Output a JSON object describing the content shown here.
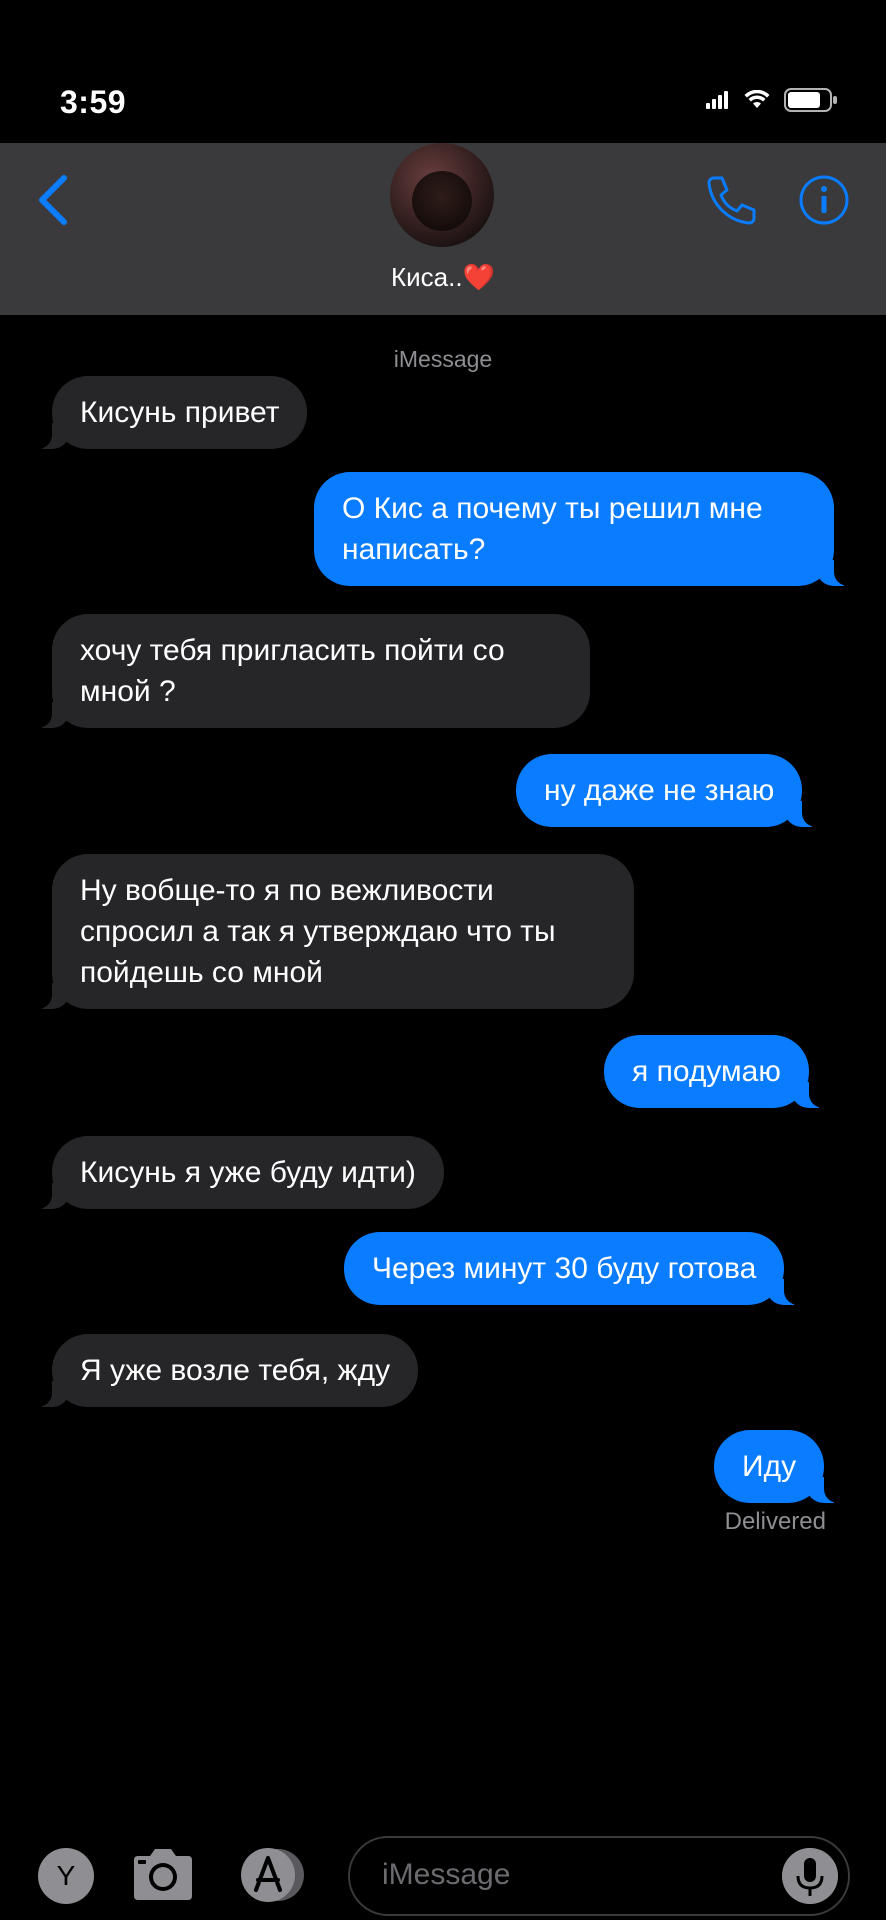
{
  "status_bar": {
    "time": "3:59"
  },
  "header": {
    "contact_name": "Киса..",
    "contact_emoji": "❤️"
  },
  "chat": {
    "service_label": "iMessage",
    "messages": [
      {
        "side": "in",
        "text": "Кисунь привет"
      },
      {
        "side": "out",
        "text": "О Кис а почему ты решил мне написать?"
      },
      {
        "side": "in",
        "text": " хочу тебя пригласить пойти со мной ?"
      },
      {
        "side": "out",
        "text": "ну даже не знаю"
      },
      {
        "side": "in",
        "text": "Ну вобще-то я по вежливости спросил а так я утверждаю что ты пойдешь со мной"
      },
      {
        "side": "out",
        "text": "я подумаю"
      },
      {
        "side": "in",
        "text": "Кисунь я уже буду идти)"
      },
      {
        "side": "out",
        "text": "Через минут 30 буду готова"
      },
      {
        "side": "in",
        "text": "Я уже возле тебя, жду"
      },
      {
        "side": "out",
        "text": "Иду"
      }
    ],
    "delivery_status": "Delivered"
  },
  "compose": {
    "app_button_label": "Y",
    "placeholder": "iMessage",
    "icons": [
      "camera-icon",
      "app-store-icon",
      "microphone-icon"
    ]
  },
  "colors": {
    "accent": "#0a7cff",
    "incoming_bubble": "#262629",
    "header_bg": "#3a3a3c",
    "secondary_text": "#8e8e93"
  }
}
